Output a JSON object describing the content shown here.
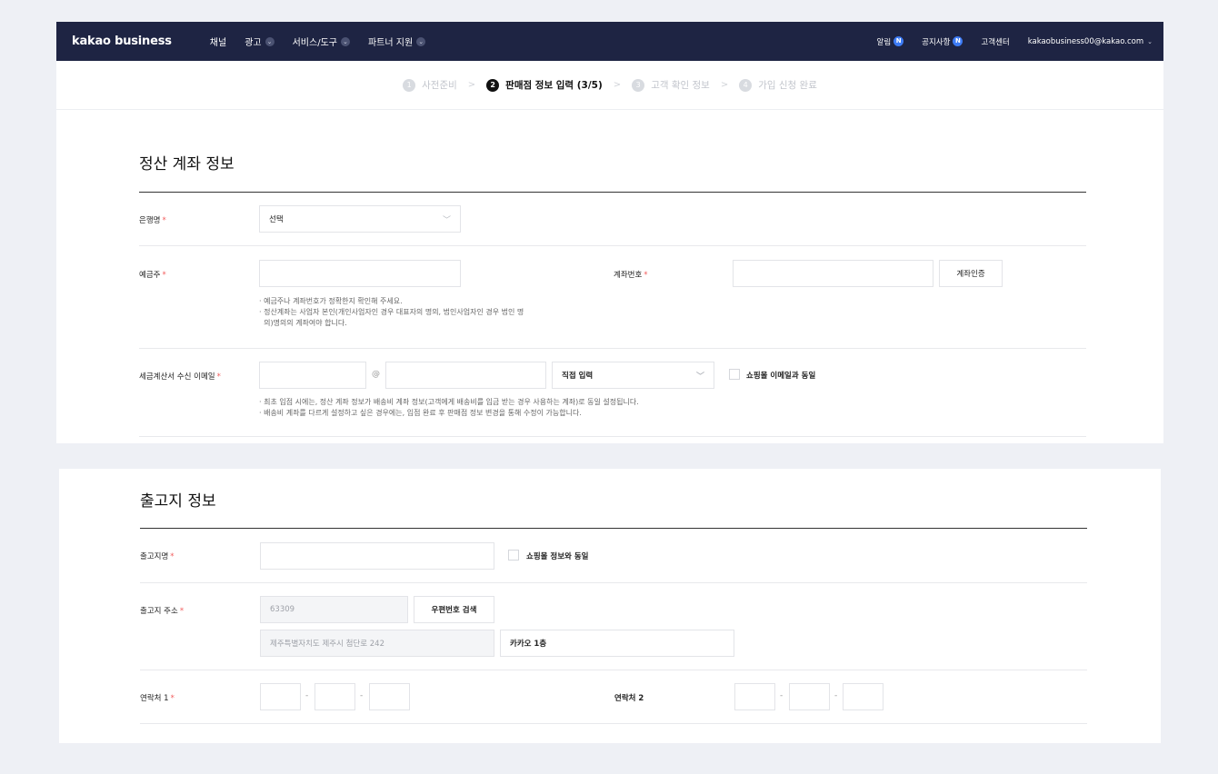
{
  "header": {
    "logo": "kakao business",
    "nav": [
      {
        "label": "채널",
        "has_dropdown": false
      },
      {
        "label": "광고",
        "has_dropdown": true
      },
      {
        "label": "서비스/도구",
        "has_dropdown": true
      },
      {
        "label": "파트너 지원",
        "has_dropdown": true
      }
    ],
    "right": {
      "alerts_label": "알림",
      "notice_label": "공지사항",
      "badge": "N",
      "support_label": "고객센터",
      "account": "kakaobusiness00@kakao.com"
    }
  },
  "steps": [
    {
      "num": "1",
      "label": "사전준비",
      "active": false
    },
    {
      "num": "2",
      "label": "판매점 정보 입력 (3/5)",
      "active": true
    },
    {
      "num": "3",
      "label": "고객 확인 정보",
      "active": false
    },
    {
      "num": "4",
      "label": "가입 신청 완료",
      "active": false
    }
  ],
  "settlement": {
    "title": "정산 계좌 정보",
    "bank_label": "은행명",
    "bank_value": "선택",
    "holder_label": "예금주",
    "account_number_label": "계좌번호",
    "verify_button": "계좌인증",
    "holder_help": [
      "· 예금주나 계좌번호가 정확한지 확인해 주세요.",
      "· 정산계좌는 사업자 본인(개인사업자인 경우 대표자의 명의, 법인사업자인 경우 법인 명",
      "  의)명의의 계좌여야 합니다."
    ],
    "email_label": "세금계산서 수신 이메일",
    "email_at": "@",
    "email_domain_select": "직접 입력",
    "same_as_mall_email": "쇼핑몰 이메일과 동일",
    "email_help": [
      "· 최초 입점 시에는, 정산 계좌 정보가 배송비 계좌 정보(고객에게 배송비를 입금 받는 경우 사용하는 계좌)로 동일 설정됩니다.",
      "· 배송비 계좌를 다르게 설정하고 싶은 경우에는, 입점 완료 후 판매점 정보 변경을 통해 수정이 가능합니다."
    ]
  },
  "shipping": {
    "title": "출고지 정보",
    "name_label": "출고지명",
    "same_as_mall_info": "쇼핑몰 정보와 동일",
    "address_label": "출고지 주소",
    "postcode": "63309",
    "postcode_button": "우편번호 검색",
    "address_line1": "제주특별자치도 제주시 첨단로 242",
    "address_line2": "카카오 1층",
    "phone1_label": "연락처 1",
    "phone2_label": "연락처 2",
    "dash": "-"
  },
  "required_mark": "*"
}
